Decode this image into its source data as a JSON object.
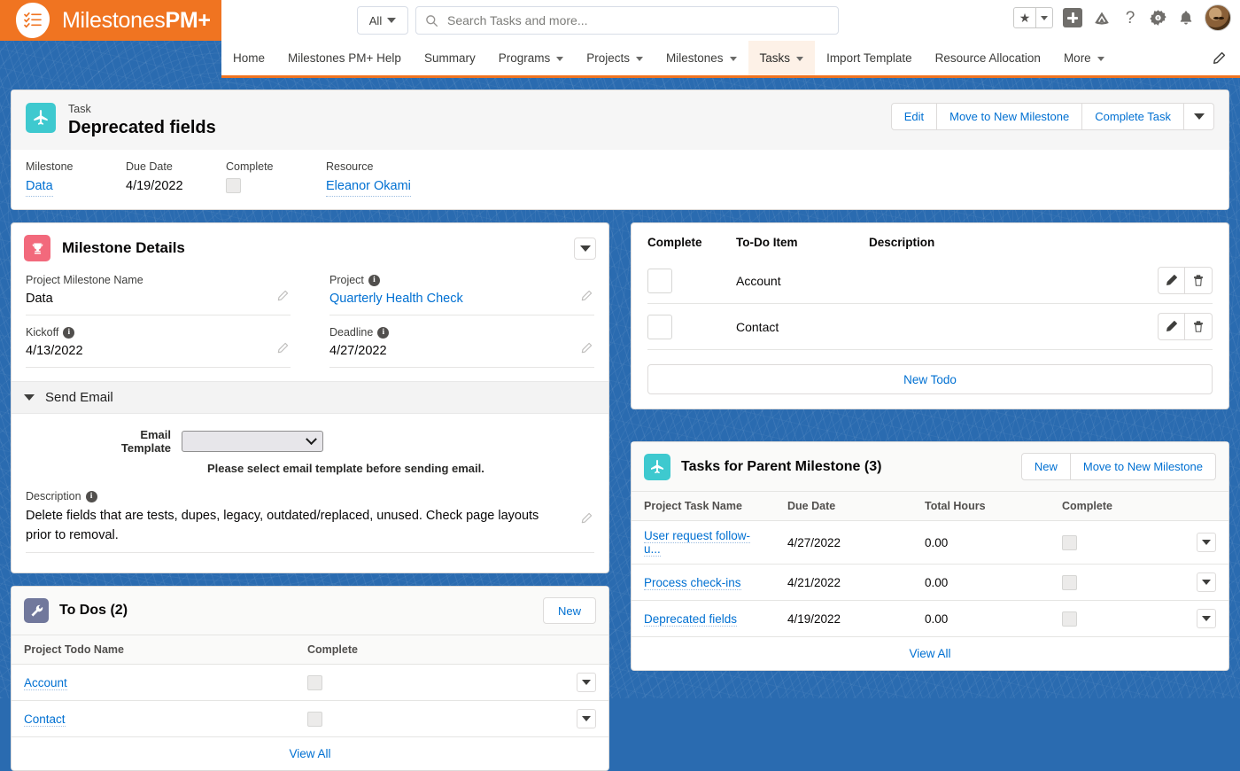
{
  "brand": {
    "name_light": "Milestones",
    "name_bold": "PM+",
    "logo_icon": "checklist-blob-icon"
  },
  "search": {
    "scope": "All",
    "placeholder": "Search Tasks and more...",
    "value": "",
    "icon": "search-icon"
  },
  "header_icons": [
    {
      "name": "favorites-star-icon",
      "glyph": "★"
    },
    {
      "name": "favorites-chevron-icon",
      "glyph": "▾"
    },
    {
      "name": "new-item-plus-icon",
      "glyph": "+"
    },
    {
      "name": "app-launcher-icon",
      "glyph": "▲"
    },
    {
      "name": "help-question-icon",
      "glyph": "?"
    },
    {
      "name": "setup-gear-icon",
      "glyph": "⚙"
    },
    {
      "name": "notifications-bell-icon",
      "glyph": "🔔"
    },
    {
      "name": "user-avatar",
      "glyph": ""
    }
  ],
  "nav": {
    "items": [
      {
        "label": "Home",
        "has_menu": false,
        "active": false
      },
      {
        "label": "Milestones PM+ Help",
        "has_menu": false,
        "active": false
      },
      {
        "label": "Summary",
        "has_menu": false,
        "active": false
      },
      {
        "label": "Programs",
        "has_menu": true,
        "active": false
      },
      {
        "label": "Projects",
        "has_menu": true,
        "active": false
      },
      {
        "label": "Milestones",
        "has_menu": true,
        "active": false
      },
      {
        "label": "Tasks",
        "has_menu": true,
        "active": true
      },
      {
        "label": "Import Template",
        "has_menu": false,
        "active": false
      },
      {
        "label": "Resource Allocation",
        "has_menu": false,
        "active": false
      },
      {
        "label": "More",
        "has_menu": true,
        "active": false
      }
    ],
    "edit_icon": "pencil-icon"
  },
  "record": {
    "object_label": "Task",
    "title": "Deprecated fields",
    "icon": "airplane-task-icon",
    "actions": [
      {
        "label": "Edit"
      },
      {
        "label": "Move to New Milestone"
      },
      {
        "label": "Complete Task"
      }
    ],
    "more_actions_icon": "chevron-down-icon",
    "fields": [
      {
        "label": "Milestone",
        "value": "Data",
        "type": "link"
      },
      {
        "label": "Due Date",
        "value": "4/19/2022",
        "type": "text"
      },
      {
        "label": "Complete",
        "value": "",
        "type": "checkbox",
        "checked": false
      },
      {
        "label": "Resource",
        "value": "Eleanor Okami",
        "type": "link"
      }
    ]
  },
  "milestone_details": {
    "title": "Milestone Details",
    "icon": "trophy-icon",
    "collapse_icon": "chevron-down-icon",
    "left_fields": [
      {
        "label": "Project Milestone Name",
        "value": "Data",
        "info": false,
        "link": false
      },
      {
        "label": "Kickoff",
        "value": "4/13/2022",
        "info": true,
        "link": false
      }
    ],
    "right_fields": [
      {
        "label": "Project",
        "value": "Quarterly Health Check",
        "info": true,
        "link": true
      },
      {
        "label": "Deadline",
        "value": "4/27/2022",
        "info": true,
        "link": false
      }
    ],
    "send_email": {
      "section_title": "Send Email",
      "toggle_icon": "chevron-down-icon",
      "field_label": "Email Template",
      "selected_value": "",
      "hint": "Please select email template before sending email."
    },
    "description": {
      "label": "Description",
      "info": true,
      "value": "Delete fields that are tests, dupes, legacy, outdated/replaced, unused. Check page layouts prior to removal."
    }
  },
  "todos_card": {
    "title": "To Dos (2)",
    "icon": "wrench-icon",
    "new_label": "New",
    "columns": [
      "Project Todo Name",
      "Complete"
    ],
    "rows": [
      {
        "name": "Account",
        "complete": false
      },
      {
        "name": "Contact",
        "complete": false
      }
    ],
    "view_all": "View All",
    "row_menu_icon": "chevron-down-icon"
  },
  "todo_items_panel": {
    "columns": [
      "Complete",
      "To-Do Item",
      "Description"
    ],
    "rows": [
      {
        "complete": false,
        "item": "Account",
        "description": ""
      },
      {
        "complete": false,
        "item": "Contact",
        "description": ""
      }
    ],
    "new_todo_label": "New Todo",
    "edit_icon": "pencil-icon",
    "delete_icon": "trash-icon"
  },
  "tasks_parent": {
    "title": "Tasks for Parent Milestone (3)",
    "icon": "airplane-task-icon",
    "buttons": [
      {
        "label": "New"
      },
      {
        "label": "Move to New Milestone"
      }
    ],
    "columns": [
      "Project Task Name",
      "Due Date",
      "Total Hours",
      "Complete"
    ],
    "rows": [
      {
        "name": "User request follow-u...",
        "due_date": "4/27/2022",
        "total_hours": "0.00",
        "complete": false
      },
      {
        "name": "Process check-ins",
        "due_date": "4/21/2022",
        "total_hours": "0.00",
        "complete": false
      },
      {
        "name": "Deprecated fields",
        "due_date": "4/19/2022",
        "total_hours": "0.00",
        "complete": false
      }
    ],
    "view_all": "View All",
    "row_menu_icon": "chevron-down-icon"
  },
  "colors": {
    "brand_orange": "#f07421",
    "page_blue": "#2a6bb0",
    "link_blue": "#0070d2",
    "task_teal": "#3ec9cf",
    "milestone_pink": "#f2697c",
    "todo_slate": "#71789c"
  }
}
